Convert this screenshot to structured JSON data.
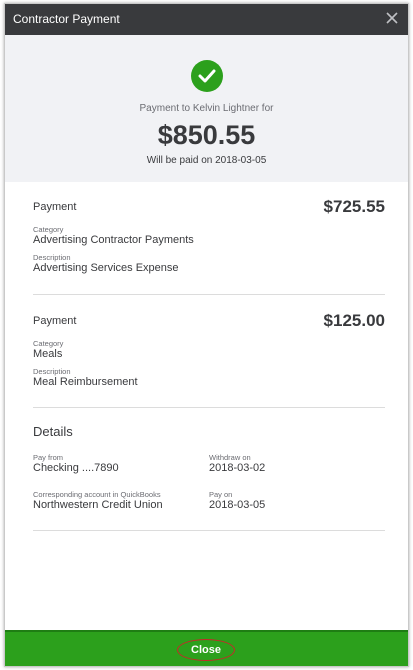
{
  "dialog": {
    "title": "Contractor Payment"
  },
  "summary": {
    "payee_line": "Payment to Kelvin Lightner for",
    "total_amount": "$850.55",
    "paid_on_line": "Will be paid on 2018-03-05"
  },
  "lines": [
    {
      "heading": "Payment",
      "amount": "$725.55",
      "category_label": "Category",
      "category": "Advertising Contractor Payments",
      "description_label": "Description",
      "description": "Advertising Services Expense"
    },
    {
      "heading": "Payment",
      "amount": "$125.00",
      "category_label": "Category",
      "category": "Meals",
      "description_label": "Description",
      "description": "Meal Reimbursement"
    }
  ],
  "details": {
    "heading": "Details",
    "pay_from_label": "Pay from",
    "pay_from": "Checking ....7890",
    "withdraw_on_label": "Withdraw on",
    "withdraw_on": "2018-03-02",
    "corresponding_label": "Corresponding account in QuickBooks",
    "corresponding": "Northwestern Credit Union",
    "pay_on_label": "Pay on",
    "pay_on": "2018-03-05"
  },
  "footer": {
    "close_label": "Close"
  },
  "colors": {
    "brand_green": "#2ca01c",
    "titlebar": "#393a3d",
    "highlight_ring": "#c62828"
  },
  "icons": {
    "success": "check-circle-icon",
    "dismiss": "close-icon"
  }
}
